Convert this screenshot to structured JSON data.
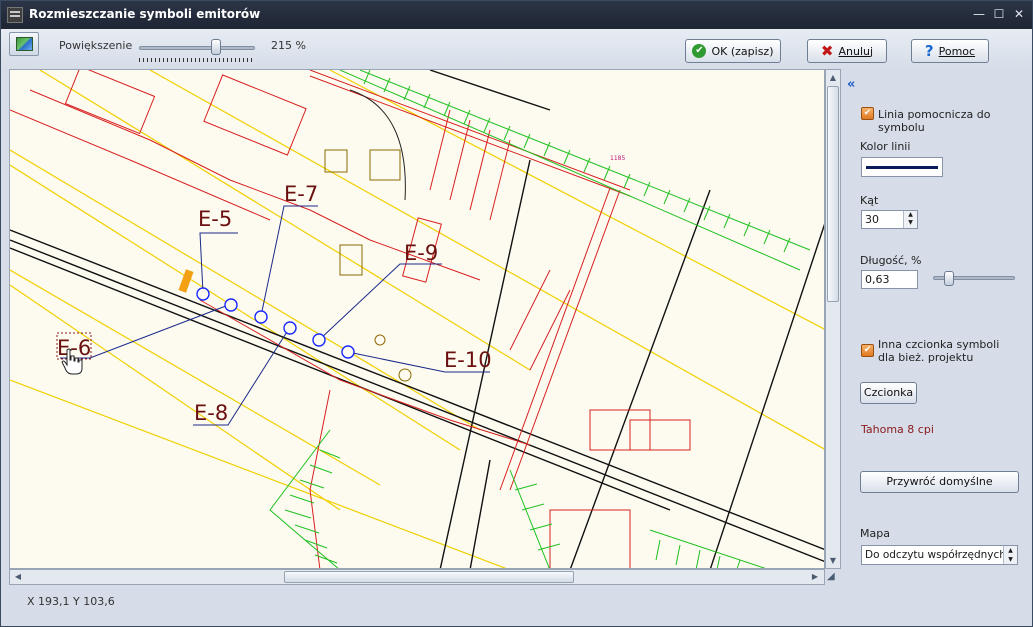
{
  "window": {
    "title": "Rozmieszczanie symboli emitorów",
    "controls": {
      "minimize": "—",
      "maximize": "☐",
      "close": "✕"
    }
  },
  "toolbar": {
    "zoom_label": "Powiększenie",
    "zoom_value": "215 %",
    "zoom_level_fraction": 0.68,
    "ok_label": "OK (zapisz)",
    "cancel_label": "Anuluj",
    "help_label": "Pomoc"
  },
  "map": {
    "emitters": [
      "E-5",
      "E-6",
      "E-7",
      "E-8",
      "E-9",
      "E-10"
    ],
    "small_label": "1185"
  },
  "status": {
    "coords": "X 193,1 Y 103,6"
  },
  "panel": {
    "collapse_glyph": "«",
    "helper_line_label": "Linia pomocnicza do symbolu",
    "helper_line_checked": true,
    "line_color_label": "Kolor linii",
    "line_color": "#0b1a5a",
    "angle_label": "Kąt",
    "angle_value": "30",
    "length_label": "Długość, %",
    "length_value": "0,63",
    "other_font_label_1": "Inna czcionka symboli",
    "other_font_label_2": "dla bież. projektu",
    "other_font_checked": true,
    "font_button": "Czcionka",
    "font_info": "Tahoma 8 cpi",
    "restore_button": "Przywróć domyślne",
    "map_label": "Mapa",
    "map_select_value": "Do odczytu współrzędnych"
  }
}
